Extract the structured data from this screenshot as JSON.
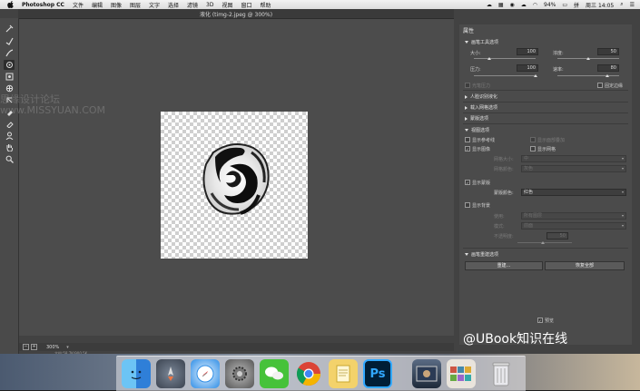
{
  "menubar": {
    "app_name": "Photoshop CC",
    "items": [
      "文件",
      "编辑",
      "图像",
      "图层",
      "文字",
      "选择",
      "滤镜",
      "3D",
      "视图",
      "窗口",
      "帮助"
    ],
    "battery": "94%",
    "clock": "周三 14:05"
  },
  "document": {
    "title": "液化 (timg-2.jpeg @ 300%)",
    "zoom": "300%"
  },
  "panel": {
    "heading": "属性",
    "brush_tool_options": {
      "title": "画笔工具选项",
      "size_label": "大小:",
      "size_value": "100",
      "density_label": "浓度:",
      "density_value": "50",
      "pressure_label": "压力:",
      "pressure_value": "100",
      "rate_label": "速率:",
      "rate_value": "80",
      "stylus_label": "光笔压力",
      "pin_edges_label": "固定边缘"
    },
    "collapsed_sections": [
      "人脸识别液化",
      "载入网格选项",
      "蒙版选项"
    ],
    "view_options": {
      "title": "视图选项",
      "show_guides": "显示参考线",
      "show_face_overlay": "显示面部叠加",
      "show_image": "显示图像",
      "show_mesh": "显示网格",
      "mesh_size_label": "网格大小:",
      "mesh_size_value": "中",
      "mesh_color_label": "网格颜色:",
      "mesh_color_value": "灰色",
      "show_mask": "显示蒙版",
      "mask_color_label": "蒙版颜色:",
      "mask_color_value": "红色",
      "show_backdrop": "显示背景",
      "use_label": "使用:",
      "use_value": "所有图层",
      "mode_label": "模式:",
      "mode_value": "前面",
      "opacity_label": "不透明度:",
      "opacity_value": "50"
    },
    "reconstruct": {
      "title": "画笔重建选项",
      "rebuild_button": "重建...",
      "restore_all_button": "恢复全部"
    },
    "preview_label": "预览"
  },
  "watermark_left": "思缘设计论坛 www.MISSYUAN.COM",
  "watermark_right": "@UBook知识在线",
  "status_bar_text": "文档:58.7K/900.5K",
  "dock": [
    "finder-icon",
    "launchpad-icon",
    "safari-icon",
    "system-preferences-icon",
    "wechat-icon",
    "chrome-icon",
    "notes-icon",
    "photoshop-icon",
    "image-preview-icon",
    "photos-icon",
    "trash-icon"
  ],
  "colors": {
    "workspace": "#424242",
    "panel": "#4b4b4b",
    "accent_ps": "#31a8ff"
  }
}
